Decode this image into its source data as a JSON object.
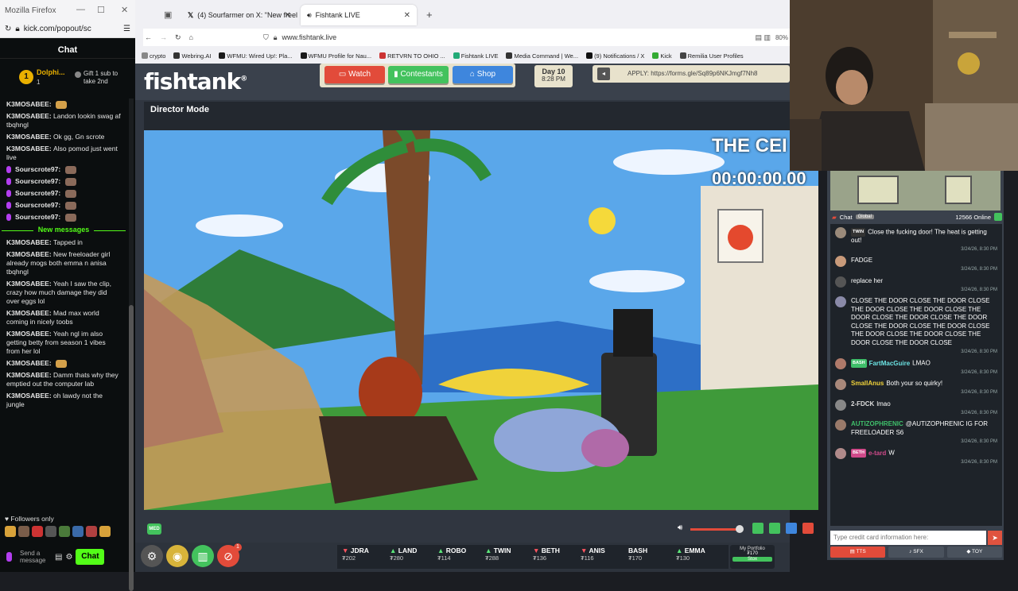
{
  "kick": {
    "window_title": "Mozilla Firefox",
    "url": "kick.com/popout/sc",
    "chat_header": "Chat",
    "pinned_user": "Dolphi...",
    "pinned_count": "1",
    "pinned_gift": "Gift 1 sub to take 2nd",
    "crown_number": "1",
    "messages": [
      {
        "user": "K3MOSABEE:",
        "text": ""
      },
      {
        "user": "K3MOSABEE:",
        "text": "Landon lookin swag af tbqhngl"
      },
      {
        "user": "K3MOSABEE:",
        "text": "Ok gg, Gn scrote"
      },
      {
        "user": "K3MOSABEE:",
        "text": "Also pomod just went live"
      },
      {
        "user": "Sourscrote97:",
        "text": ""
      },
      {
        "user": "Sourscrote97:",
        "text": ""
      },
      {
        "user": "Sourscrote97:",
        "text": ""
      },
      {
        "user": "Sourscrote97:",
        "text": ""
      },
      {
        "user": "Sourscrote97:",
        "text": ""
      }
    ],
    "new_messages_label": "New messages",
    "messages_after": [
      {
        "user": "K3MOSABEE:",
        "text": "Tapped in"
      },
      {
        "user": "K3MOSABEE:",
        "text": "New freeloader girl already mogs both emma n anisa tbqhngl"
      },
      {
        "user": "K3MOSABEE:",
        "text": "Yeah I saw the clip, crazy how much damage they did over eggs lol"
      },
      {
        "user": "K3MOSABEE:",
        "text": "Mad max world coming in nicely toobs"
      },
      {
        "user": "K3MOSABEE:",
        "text": "Yeah ngl im also getting betty from season 1 vibes from her lol"
      },
      {
        "user": "K3MOSABEE:",
        "text": ""
      },
      {
        "user": "K3MOSABEE:",
        "text": "Damm thats why they emptied out the computer lab"
      },
      {
        "user": "K3MOSABEE:",
        "text": "oh lawdy not the jungle"
      }
    ],
    "followers_only": "Followers only",
    "send_placeholder": "Send a message",
    "chat_button": "Chat"
  },
  "browser": {
    "tabs": [
      {
        "label": "(4) Sourfarmer on X: \"New freel"
      },
      {
        "label": "Fishtank LIVE"
      }
    ],
    "url": "www.fishtank.live",
    "zoom": "80%",
    "bookmarks": [
      "crypto",
      "Webring.AI",
      "WFMU: Wired Up!: Pla...",
      "WFMU Profile for Nau...",
      "RETVRN TO OHIO ...",
      "Fishtank LIVE",
      "Media Command | We...",
      "(9) Notifications / X",
      "Kick",
      "Remilia User Profiles"
    ]
  },
  "fishtank": {
    "logo": "fishtank",
    "nav": {
      "watch": "Watch",
      "contestants": "Contestants",
      "shop": "Shop"
    },
    "day": "Day 10",
    "time": "8:28 PM",
    "apply": "APPLY: https://forms.gle/Sq89p6NKJmgf7Nh8",
    "director_mode": "Director Mode",
    "video_title": "THE CEI",
    "video_timer": "00:00:00.00",
    "quality": "MED",
    "notif_count": "1",
    "ticker": [
      {
        "name": "JDRA",
        "price": "₮202",
        "dir": "down"
      },
      {
        "name": "LAND",
        "price": "₮280",
        "dir": "up"
      },
      {
        "name": "ROBO",
        "price": "₮114",
        "dir": "up"
      },
      {
        "name": "TWIN",
        "price": "₮288",
        "dir": "up"
      },
      {
        "name": "BETH",
        "price": "₮136",
        "dir": "down"
      },
      {
        "name": "ANIS",
        "price": "₮116",
        "dir": "down"
      },
      {
        "name": "BASH",
        "price": "₮170",
        "dir": "flat"
      },
      {
        "name": "EMMA",
        "price": "₮130",
        "dir": "up"
      }
    ],
    "portfolio_label": "My Portfolio",
    "portfolio_value": "₮170",
    "portfolio_btn": "Stox"
  },
  "rchat": {
    "title": "Chat",
    "global_tab": "Global",
    "online": "12566 Online",
    "messages": [
      {
        "tag": "TWIN",
        "user": "",
        "text": "Close the fucking door! The heat is getting out!",
        "ts": "3/24/26, 8:30 PM"
      },
      {
        "tag": "",
        "user": "",
        "text": "FADGE",
        "ts": "3/24/26, 8:30 PM"
      },
      {
        "tag": "",
        "user": "",
        "text": "replace her",
        "ts": "3/24/26, 8:30 PM"
      },
      {
        "tag": "",
        "user": "",
        "text": "CLOSE THE DOOR CLOSE THE DOOR CLOSE THE DOOR CLOSE THE DOOR CLOSE THE DOOR CLOSE THE DOOR CLOSE THE DOOR CLOSE THE DOOR CLOSE THE DOOR CLOSE THE DOOR CLOSE THE DOOR CLOSE THE DOOR CLOSE THE DOOR CLOSE",
        "ts": "3/24/26, 8:30 PM"
      },
      {
        "tag": "BASH",
        "user": "FartMacGuire",
        "text": "LMAO",
        "ts": "3/24/26, 8:30 PM"
      },
      {
        "tag": "",
        "user": "SmallAnus",
        "text": "Both your so quirky!",
        "ts": "3/24/26, 8:30 PM"
      },
      {
        "tag": "",
        "user": "2-FDCK",
        "text": "lmao",
        "ts": "3/24/26, 8:30 PM"
      },
      {
        "tag": "",
        "user": "AUTIZOPHRENIC",
        "text": "@AUTIZOPHRENIC IG FOR FREELOADER S6",
        "ts": "3/24/26, 8:30 PM"
      },
      {
        "tag": "BETH",
        "user": "e-tard",
        "text": "W",
        "ts": "3/24/26, 8:30 PM"
      }
    ],
    "input_placeholder": "Type credit card information here:",
    "btn_tts": "TTS",
    "btn_sfx": "SFX",
    "btn_toy": "TOY"
  }
}
